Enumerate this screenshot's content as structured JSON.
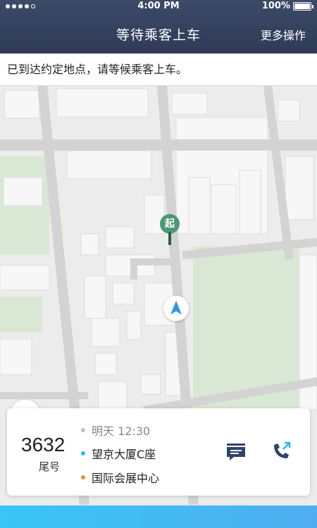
{
  "status_bar": {
    "time": "4:00 PM",
    "battery": "100%",
    "battery_level": 1.0
  },
  "header": {
    "title": "等待乘客上车",
    "more_label": "更多操作"
  },
  "notice": "已到达约定地点，请等候乘客上车。",
  "map": {
    "start_marker_label": "起",
    "colors": {
      "road": "#d3d3d3",
      "park": "#d9e8d4",
      "building": "#f7f7f7",
      "start_marker": "#4a9a76",
      "location_arrow": "#2e98e6"
    },
    "icons": [
      "traffic-light-icon",
      "locate-icon",
      "navigation-arrow-icon"
    ]
  },
  "order": {
    "tail_number": "3632",
    "tail_label": "尾号",
    "time": "明天 12:30",
    "from": "望京大厦C座",
    "to": "国际会展中心",
    "colors": {
      "time_dot": "#b8bfc8",
      "from_dot": "#2fb7ea",
      "to_dot": "#f08a3c",
      "action_icon": "#2f4468"
    },
    "icons": [
      "message-icon",
      "phone-icon"
    ]
  }
}
